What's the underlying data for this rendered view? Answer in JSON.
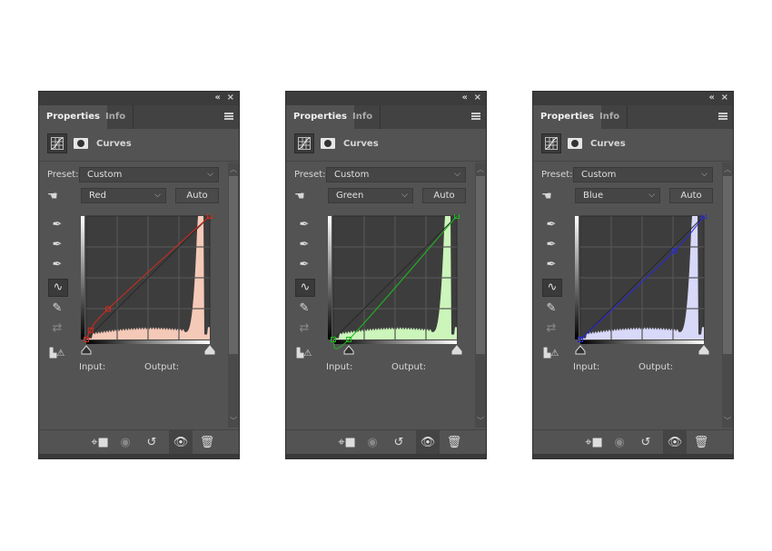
{
  "panels": [
    {
      "title_tab": "Properties",
      "info_tab": "Info",
      "adjustment": "Curves",
      "preset_label": "Preset:",
      "preset": "Custom",
      "channel": "Red",
      "auto_label": "Auto",
      "input_label": "Input:",
      "output_label": "Output:",
      "curve_color": "#d42a1c",
      "hist_color": "#f5c9b8",
      "curve_points": [
        [
          0,
          0
        ],
        [
          9,
          19
        ],
        [
          45,
          63
        ],
        [
          255,
          255
        ]
      ]
    },
    {
      "title_tab": "Properties",
      "info_tab": "Info",
      "adjustment": "Curves",
      "preset_label": "Preset:",
      "preset": "Custom",
      "channel": "Green",
      "auto_label": "Auto",
      "input_label": "Input:",
      "output_label": "Output:",
      "curve_color": "#1fb81f",
      "hist_color": "#ccf5bb",
      "curve_points": [
        [
          0,
          0
        ],
        [
          32,
          0
        ],
        [
          255,
          255
        ]
      ]
    },
    {
      "title_tab": "Properties",
      "info_tab": "Info",
      "adjustment": "Curves",
      "preset_label": "Preset:",
      "preset": "Custom",
      "channel": "Blue",
      "auto_label": "Auto",
      "input_label": "Input:",
      "output_label": "Output:",
      "curve_color": "#2a2ae0",
      "hist_color": "#d8d8f8",
      "curve_points": [
        [
          0,
          0
        ],
        [
          194,
          183
        ],
        [
          255,
          255
        ]
      ]
    }
  ],
  "icons": {
    "collapse": "«",
    "close": "×",
    "dropdown": "⌵"
  }
}
